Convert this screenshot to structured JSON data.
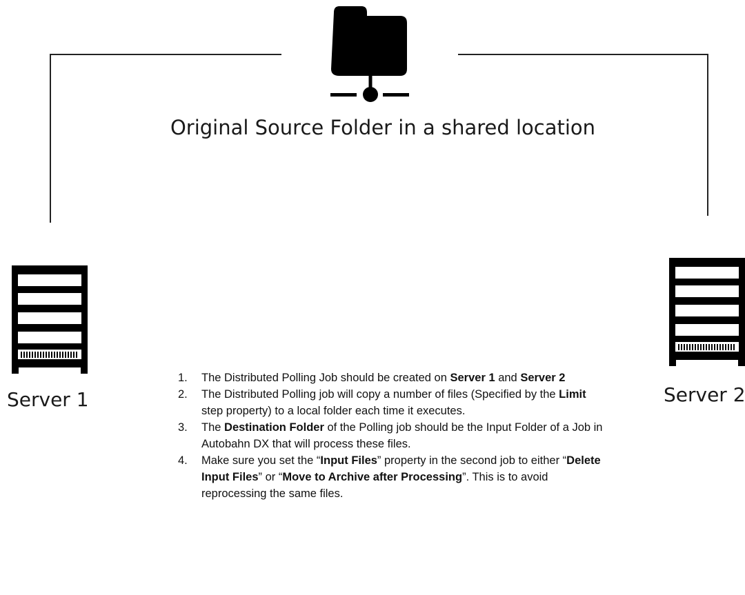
{
  "source": {
    "label": "Original Source Folder in a shared location",
    "icon": "network-folder-icon"
  },
  "servers": [
    {
      "label": "Server 1",
      "icon": "server-rack-icon"
    },
    {
      "label": "Server 2",
      "icon": "server-rack-icon"
    }
  ],
  "steps": [
    {
      "number": "1.",
      "parts": [
        {
          "text": "The Distributed Polling Job should be created on "
        },
        {
          "text": "Server 1",
          "bold": true
        },
        {
          "text": " and "
        },
        {
          "text": "Server 2",
          "bold": true
        }
      ]
    },
    {
      "number": "2.",
      "parts": [
        {
          "text": "The Distributed Polling job will copy a number of files (Specified by the "
        },
        {
          "text": "Limit",
          "bold": true
        },
        {
          "text": " step property) to a local folder each time it executes."
        }
      ]
    },
    {
      "number": "3.",
      "parts": [
        {
          "text": "The "
        },
        {
          "text": "Destination Folder",
          "bold": true
        },
        {
          "text": " of the Polling job should be the Input Folder of a Job in Autobahn DX that will process these files."
        }
      ]
    },
    {
      "number": "4.",
      "parts": [
        {
          "text": " Make sure you set the “"
        },
        {
          "text": "Input Files",
          "bold": true
        },
        {
          "text": "” property in the second job to either “"
        },
        {
          "text": "Delete Input Files",
          "bold": true
        },
        {
          "text": "” or “"
        },
        {
          "text": "Move to Archive after Processing",
          "bold": true
        },
        {
          "text": "”. This is to avoid reprocessing the same files."
        }
      ]
    }
  ]
}
